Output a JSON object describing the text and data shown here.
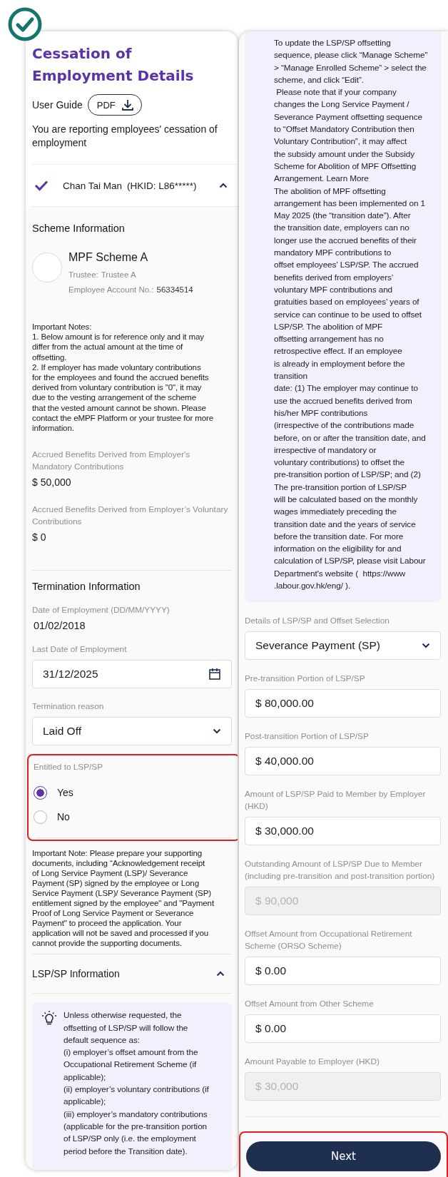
{
  "left_panel": {
    "title": "Cessation of Employment Details",
    "user_guide": {
      "label": "User Guide",
      "button": "PDF"
    },
    "description": "You are reporting employees' cessation of employment",
    "employee": {
      "name": "Chan Tai Man",
      "hkid": "(HKID: L86*****)",
      "checked": true,
      "expanded": true
    },
    "scheme_information": {
      "heading": "Scheme Information",
      "scheme_name": "MPF Scheme A",
      "trustee_label": "Trustee:",
      "trustee": "Trustee A",
      "account_label": "Employee Account No.:",
      "account_no": "56334514"
    },
    "important_notes": [
      "Important Notes:",
      "1. Below amount is for reference only and it may",
      "differ from the actual amount at the time of",
      "offsetting.",
      "2. If employer has made voluntary contributions",
      "for the employees and found the accrued benefits",
      "derived from voluntary contribution is \"0\", it may",
      "due to the vesting arrangement of the scheme",
      "that the vested amount cannot be shown. Please",
      "contact the eMPF Platform or your trustee for more",
      "information."
    ],
    "accrued_benefits": [
      {
        "label": "Accrued Benefits Derived from Employer's Mandatory Contributions",
        "value": "$ 50,000"
      },
      {
        "label": "Accrued Benefits Derived from Employer’s Voluntary Contributions",
        "value": "$ 0"
      }
    ],
    "termination_information": {
      "heading": "Termination Information",
      "fields": [
        {
          "kind": "text",
          "label": "Date of Employment (DD/MM/YYYY)",
          "value": "01/02/2018"
        },
        {
          "kind": "date",
          "label": "Last Date of Employment",
          "value": "31/12/2025"
        },
        {
          "kind": "select",
          "label": "Termination reason",
          "value": "Laid Off"
        }
      ]
    },
    "entitled": {
      "label": "Entitled to LSP/SP",
      "options": [
        {
          "label": "Yes",
          "selected": true
        },
        {
          "label": "No",
          "selected": false
        }
      ]
    },
    "important_note": [
      "Important Note: Please prepare your supporting",
      "documents, including “Acknowledgement receipt",
      "of Long Service Payment (LSP)/ Severance",
      "Payment (SP) signed by the employee or Long",
      "Service Payment (LSP)/ Severance Payment (SP)",
      "entitlement signed by the employee\" and \"Payment",
      "Proof of Long Service Payment or Severance",
      "Payment\" to proceed the application. Your",
      "application will not be saved and processed if you",
      "cannot provide the supporting documents."
    ],
    "lsp_section": {
      "heading": "LSP/SP Information",
      "expanded": true
    },
    "tip_lines": [
      "Unless otherwise requested, the",
      "offsetting of LSP/SP will follow the",
      "default sequence as:",
      "(i) employer’s offset amount from the",
      "Occupational Retirement Scheme (if",
      "applicable);",
      "(ii) employer’s voluntary contributions (if",
      "applicable);",
      "(iii) employer’s mandatory contributions",
      "(applicable for the pre-transition portion",
      "of LSP/SP only (i.e. the employment",
      "period before the Transition date)."
    ]
  },
  "right_panel": {
    "tip_lines": [
      "To update the LSP/SP offsetting",
      "sequence, please click “Manage Scheme”",
      "> “Manage Enrolled Scheme” > select the",
      "scheme, and click “Edit”.",
      " Please note that if your company",
      "changes the Long Service Payment /",
      "Severance Payment offsetting sequence",
      "to “Offset Mandatory Contribution then",
      "Voluntary Contribution”, it may affect",
      "the subsidy amount under the Subsidy",
      "Scheme for Abolition of MPF Offsetting",
      "Arrangement. Learn More",
      "The abolition of MPF offsetting",
      "arrangement has been implemented on 1",
      "May 2025 (the “transition date”). After",
      "the transition date, employers can no",
      "longer use the accrued benefits of their",
      "mandatory MPF contributions to",
      "offset employees’ LSP/SP. The accrued",
      "benefits derived from employers’",
      "voluntary MPF contributions and",
      "gratuities based on employees’ years of",
      "service can continue to be used to offset",
      "LSP/SP. The abolition of MPF",
      "offsetting arrangement has no",
      "retrospective effect. If an employee",
      "is already in employment before the",
      "transition",
      "date: (1) The employer may continue to",
      "use the accrued benefits derived from",
      "his/her MPF contributions",
      "(irrespective of the contributions made",
      "before, on or after the transition date, and",
      "irrespective of mandatory or",
      "voluntary contributions) to offset the",
      "pre-transition portion of LSP/SP; and (2)",
      "The pre-transition portion of LSP/SP",
      "will be calculated based on the monthly",
      "wages immediately preceding the",
      "transition date and the years of service",
      "before the transition date. For more",
      "information on the eligibility for and",
      "calculation of LSP/SP, please visit Labour",
      "Department's website (  https://www",
      ".labour.gov.hk/eng/ )."
    ],
    "fields": [
      {
        "kind": "select",
        "label": "Details of LSP/SP and Offset Selection",
        "value": "Severance Payment (SP)",
        "disabled": false
      },
      {
        "kind": "input",
        "label": "Pre-transition Portion of LSP/SP",
        "value": "$ 80,000.00",
        "disabled": false
      },
      {
        "kind": "input",
        "label": "Post-transition Portion of LSP/SP",
        "value": "$ 40,000.00",
        "disabled": false
      },
      {
        "kind": "input",
        "label": "Amount of LSP/SP Paid to Member by Employer (HKD)",
        "value": "$ 30,000.00",
        "disabled": false
      },
      {
        "kind": "input",
        "label": "Outstanding Amount of LSP/SP Due to Member (including pre-transition and post-transition portion)",
        "value": "$ 90,000",
        "disabled": true
      },
      {
        "kind": "input",
        "label": "Offset Amount from Occupational Retirement Scheme (ORSO Scheme)",
        "value": "$ 0.00",
        "disabled": false
      },
      {
        "kind": "input",
        "label": "Offset Amount from Other Scheme",
        "value": "$ 0.00",
        "disabled": false
      },
      {
        "kind": "input",
        "label": "Amount Payable to Employer (HKD)",
        "value": "$ 30,000",
        "disabled": true
      }
    ],
    "next_button": "Next"
  }
}
